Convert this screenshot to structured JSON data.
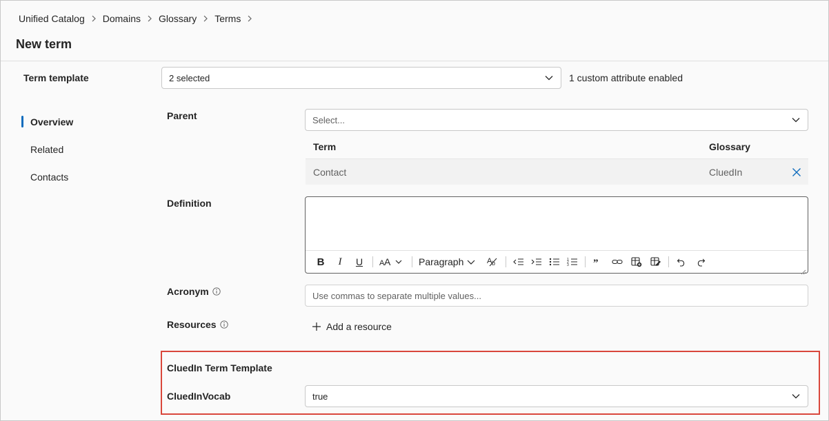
{
  "breadcrumb": [
    "Unified Catalog",
    "Domains",
    "Glossary",
    "Terms"
  ],
  "page_title": "New term",
  "term_template": {
    "label": "Term template",
    "value": "2 selected",
    "note": "1 custom attribute enabled"
  },
  "nav": {
    "items": [
      {
        "label": "Overview",
        "active": true
      },
      {
        "label": "Related",
        "active": false
      },
      {
        "label": "Contacts",
        "active": false
      }
    ]
  },
  "parent": {
    "label": "Parent",
    "placeholder": "Select...",
    "table": {
      "headers": [
        "Term",
        "Glossary"
      ],
      "rows": [
        {
          "term": "Contact",
          "glossary": "CluedIn"
        }
      ]
    }
  },
  "definition": {
    "label": "Definition",
    "toolbar": {
      "paragraph_label": "Paragraph"
    }
  },
  "acronym": {
    "label": "Acronym",
    "placeholder": "Use commas to separate multiple values..."
  },
  "resources": {
    "label": "Resources",
    "add_label": "Add a resource"
  },
  "custom_template": {
    "title": "CluedIn Term Template",
    "field_label": "CluedInVocab",
    "field_value": "true"
  },
  "colors": {
    "accent": "#0f6cbd",
    "highlight_border": "#d9463b",
    "remove_icon": "#0f6cbd"
  }
}
